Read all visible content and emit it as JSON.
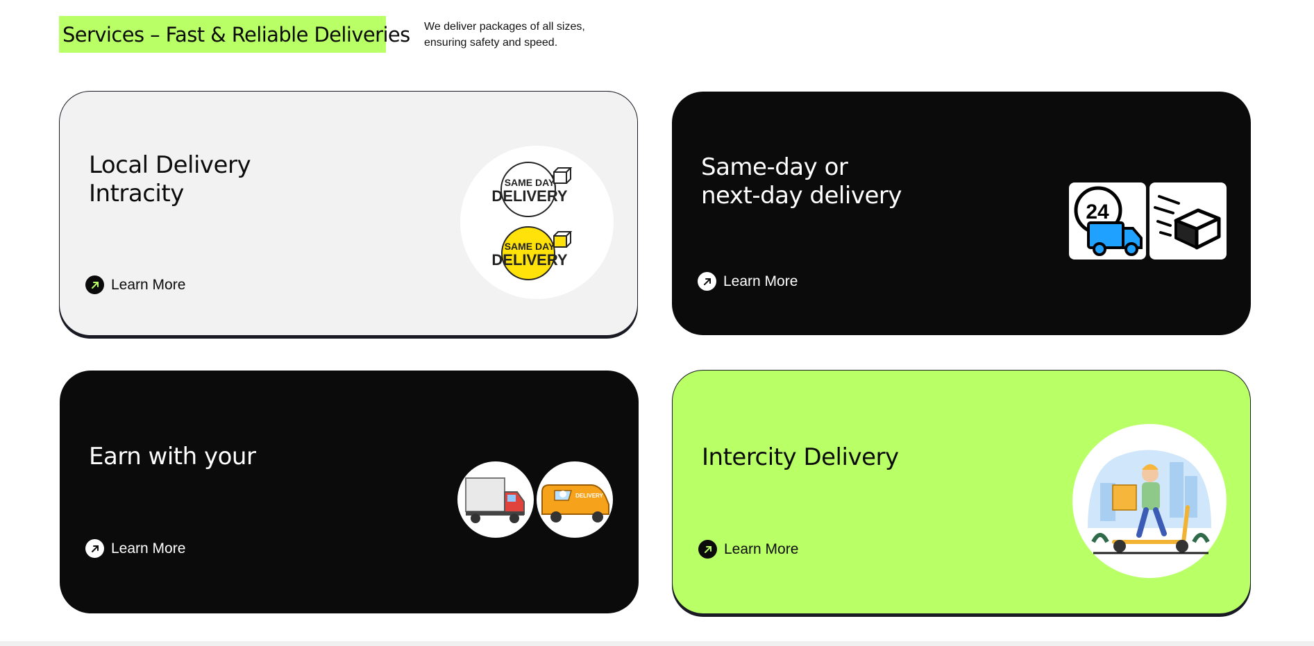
{
  "header": {
    "title": "Services – Fast & Reliable Deliveries",
    "subtitle": "We deliver packages of all sizes, ensuring safety and speed."
  },
  "colors": {
    "accent": "#b9ff66",
    "dark": "#0b0b0b",
    "light": "#f2f2f2"
  },
  "cards": [
    {
      "title": "Local Delivery\nIntracity",
      "cta": "Learn More",
      "theme": "light",
      "badge_top_line1": "SAME DAY",
      "badge_top_line2": "DELIVERY",
      "badge_bottom_line1": "SAME DAY",
      "badge_bottom_line2": "DELIVERY",
      "icons": [
        "same-day-delivery-badge-icon",
        "same-day-delivery-yellow-badge-icon"
      ]
    },
    {
      "title": "Same-day or\nnext-day delivery",
      "cta": "Learn More",
      "theme": "dark",
      "tile_number": "24",
      "icons": [
        "24-hour-truck-icon",
        "fast-box-icon"
      ]
    },
    {
      "title": "Earn with your",
      "cta": "Learn More",
      "theme": "dark",
      "van_label": "DELIVERY",
      "icons": [
        "truck-icon",
        "delivery-van-icon"
      ]
    },
    {
      "title": "Intercity Delivery",
      "cta": "Learn More",
      "theme": "green",
      "icons": [
        "scooter-courier-icon"
      ]
    }
  ]
}
